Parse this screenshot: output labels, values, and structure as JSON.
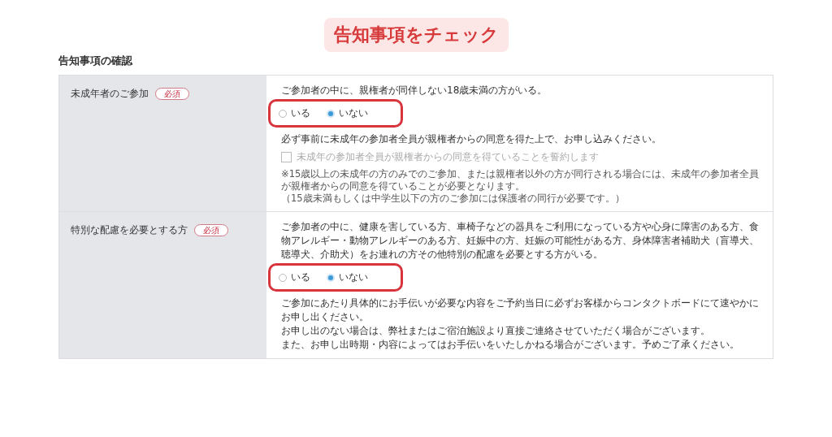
{
  "banner": "告知事項をチェック",
  "heading": "告知事項の確認",
  "rows": [
    {
      "label": "未成年者のご参加",
      "badge": "必須",
      "question": "ご参加者の中に、親権者が同伴しない18歳未満の方がいる。",
      "highlighted": true,
      "options": [
        {
          "label": "いる",
          "selected": false
        },
        {
          "label": "いない",
          "selected": true
        }
      ],
      "blocks": [
        {
          "kind": "text",
          "text": "必ず事前に未成年の参加者全員が親権者からの同意を得た上で、お申し込みください。"
        },
        {
          "kind": "checkbox",
          "text": "未成年の参加者全員が親権者からの同意を得ていることを誓約します",
          "checked": false,
          "disabled": true
        },
        {
          "kind": "note",
          "text": "※15歳以上の未成年の方のみでのご参加、または親権者以外の方が同行される場合には、未成年の参加者全員が親権者からの同意を得ていることが必要となります。"
        },
        {
          "kind": "note",
          "text": "（15歳未満もしくは中学生以下の方のご参加には保護者の同行が必要です。）"
        }
      ]
    },
    {
      "label": "特別な配慮を必要とする方",
      "badge": "必須",
      "question": "ご参加者の中に、健康を害している方、車椅子などの器具をご利用になっている方や心身に障害のある方、食物アレルギー・動物アレルギーのある方、妊娠中の方、妊娠の可能性がある方、身体障害者補助犬（盲導犬、聴導犬、介助犬）をお連れの方その他特別の配慮を必要とする方がいる。",
      "highlighted": true,
      "options": [
        {
          "label": "いる",
          "selected": false
        },
        {
          "label": "いない",
          "selected": true
        }
      ],
      "blocks": [
        {
          "kind": "text",
          "text": "ご参加にあたり具体的にお手伝いが必要な内容をご予約当日に必ずお客様からコンタクトボードにて速やかにお申し出ください。"
        },
        {
          "kind": "text",
          "text": "お申し出のない場合は、弊社またはご宿泊施設より直接ご連絡させていただく場合がございます。"
        },
        {
          "kind": "text",
          "text": "また、お申し出時期・内容によってはお手伝いをいたしかねる場合がございます。予めご了承ください。"
        }
      ]
    }
  ]
}
